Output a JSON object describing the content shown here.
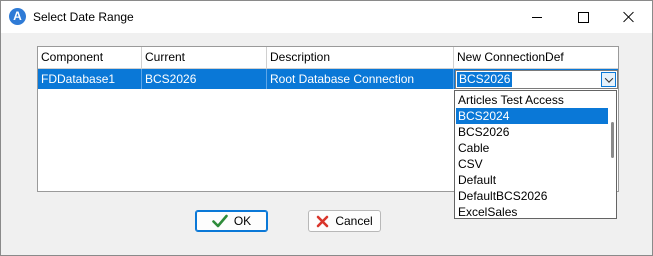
{
  "window": {
    "title": "Select Date Range",
    "app_icon_letter": "A"
  },
  "grid": {
    "columns": [
      "Component",
      "Current",
      "Description",
      "New ConnectionDef"
    ],
    "rows": [
      {
        "component": "FDDatabase1",
        "current": "BCS2026",
        "description": "Root Database Connection",
        "new_connection_def": "BCS2026"
      }
    ]
  },
  "dropdown": {
    "items": [
      "Articles Test Access",
      "BCS2024",
      "BCS2026",
      "Cable",
      "CSV",
      "Default",
      "DefaultBCS2026",
      "ExcelSales"
    ],
    "highlighted": "BCS2024"
  },
  "buttons": {
    "ok_label": "OK",
    "cancel_label": "Cancel"
  },
  "colors": {
    "selection": "#0a78d7",
    "ok_icon": "#2e8b3a",
    "cancel_icon": "#d9352b"
  },
  "icons": {
    "ok": "check-icon",
    "cancel": "x-icon",
    "combo": "chevron-down-icon"
  }
}
